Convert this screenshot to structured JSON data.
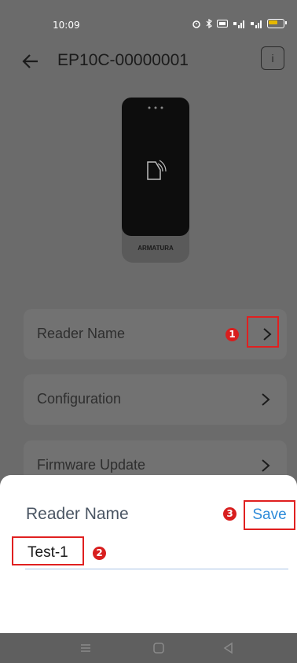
{
  "status_bar": {
    "time": "10:09",
    "icons": [
      "alarm-icon",
      "bluetooth-icon",
      "hd-icon",
      "signal-icon",
      "signal-icon",
      "battery-icon"
    ]
  },
  "header": {
    "title": "EP10C-00000001",
    "info_label": "i"
  },
  "device": {
    "brand": "ARMATURA"
  },
  "menu": [
    {
      "label": "Reader Name"
    },
    {
      "label": "Configuration"
    },
    {
      "label": "Firmware Update"
    }
  ],
  "dialog": {
    "title": "Reader Name",
    "save_label": "Save",
    "input_value": "Test-1"
  },
  "annotations": {
    "mark1": "1",
    "mark2": "2",
    "mark3": "3"
  },
  "colors": {
    "overlay": "#6b6b6b",
    "accent": "#2e8bd9",
    "highlight": "#e02020"
  }
}
